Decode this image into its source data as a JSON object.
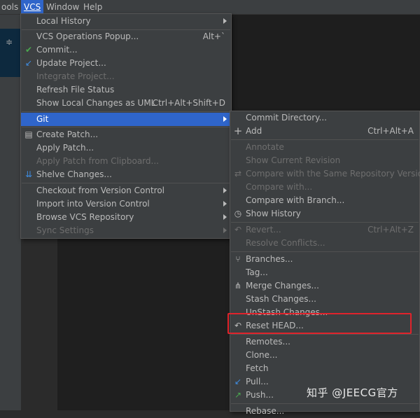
{
  "menubar": {
    "items": [
      {
        "label": "ools"
      },
      {
        "label": "VCS"
      },
      {
        "label": "Window"
      },
      {
        "label": "Help"
      }
    ]
  },
  "vcs_menu": {
    "items": [
      {
        "label": "Local History",
        "shortcut": "",
        "submenu": true,
        "enabled": true
      },
      {
        "label": "VCS Operations Popup...",
        "shortcut": "Alt+`",
        "enabled": true
      },
      {
        "label": "Commit...",
        "icon": "checkmark-icon",
        "enabled": true
      },
      {
        "label": "Update Project...",
        "icon": "update-arrow-icon",
        "enabled": true
      },
      {
        "label": "Integrate Project...",
        "enabled": false
      },
      {
        "label": "Refresh File Status",
        "enabled": true
      },
      {
        "label": "Show Local Changes as UML",
        "shortcut": "Ctrl+Alt+Shift+D",
        "enabled": true
      },
      {
        "label": "Git",
        "submenu": true,
        "enabled": true,
        "active": true
      },
      {
        "label": "Create Patch...",
        "icon": "patch-icon",
        "enabled": true
      },
      {
        "label": "Apply Patch...",
        "enabled": true
      },
      {
        "label": "Apply Patch from Clipboard...",
        "enabled": false
      },
      {
        "label": "Shelve Changes...",
        "icon": "shelve-icon",
        "enabled": true
      },
      {
        "label": "Checkout from Version Control",
        "submenu": true,
        "enabled": true
      },
      {
        "label": "Import into Version Control",
        "submenu": true,
        "enabled": true
      },
      {
        "label": "Browse VCS Repository",
        "submenu": true,
        "enabled": true
      },
      {
        "label": "Sync Settings",
        "submenu": true,
        "enabled": false
      }
    ]
  },
  "git_menu": {
    "items": [
      {
        "label": "Commit Directory...",
        "enabled": true
      },
      {
        "label": "Add",
        "shortcut": "Ctrl+Alt+A",
        "icon": "plus-icon",
        "enabled": true
      },
      {
        "label": "Annotate",
        "enabled": false
      },
      {
        "label": "Show Current Revision",
        "enabled": false
      },
      {
        "label": "Compare with the Same Repository Version",
        "icon": "compare-icon",
        "enabled": false
      },
      {
        "label": "Compare with...",
        "enabled": false
      },
      {
        "label": "Compare with Branch...",
        "enabled": true
      },
      {
        "label": "Show History",
        "icon": "clock-icon",
        "enabled": true
      },
      {
        "label": "Revert...",
        "shortcut": "Ctrl+Alt+Z",
        "icon": "revert-icon",
        "enabled": false
      },
      {
        "label": "Resolve Conflicts...",
        "enabled": false
      },
      {
        "label": "Branches...",
        "icon": "branch-icon",
        "enabled": true
      },
      {
        "label": "Tag...",
        "enabled": true
      },
      {
        "label": "Merge Changes...",
        "icon": "merge-icon",
        "enabled": true
      },
      {
        "label": "Stash Changes...",
        "enabled": true
      },
      {
        "label": "UnStash Changes...",
        "enabled": true
      },
      {
        "label": "Reset HEAD...",
        "icon": "reset-icon",
        "enabled": true
      },
      {
        "label": "Remotes...",
        "enabled": true
      },
      {
        "label": "Clone...",
        "enabled": true
      },
      {
        "label": "Fetch",
        "enabled": true
      },
      {
        "label": "Pull...",
        "icon": "pull-icon",
        "enabled": true
      },
      {
        "label": "Push...",
        "icon": "push-icon",
        "enabled": true
      },
      {
        "label": "Rebase...",
        "enabled": true
      }
    ]
  },
  "watermark": {
    "text": "知乎 @JEECG官方"
  },
  "colors": {
    "menu_bg": "#3c3f41",
    "selection": "#2f65ca",
    "highlight_box": "#e0232b",
    "check_green": "#4aa84f",
    "update_blue": "#3f8ce0"
  }
}
